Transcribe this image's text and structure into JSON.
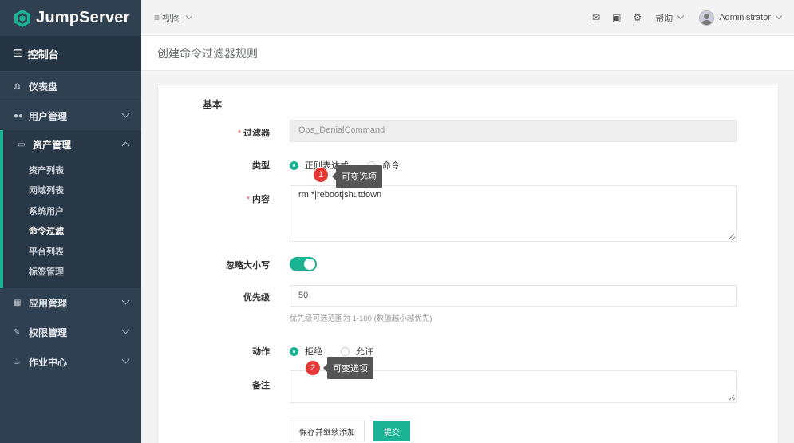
{
  "sidebar": {
    "brand": "JumpServer",
    "console": "控制台",
    "items": [
      {
        "label": "仪表盘"
      },
      {
        "label": "用户管理"
      },
      {
        "label": "资产管理"
      },
      {
        "label": "应用管理"
      },
      {
        "label": "权限管理"
      },
      {
        "label": "作业中心"
      }
    ],
    "subitems": [
      {
        "label": "资产列表"
      },
      {
        "label": "网域列表"
      },
      {
        "label": "系统用户"
      },
      {
        "label": "命令过滤"
      },
      {
        "label": "平台列表"
      },
      {
        "label": "标签管理"
      }
    ]
  },
  "topbar": {
    "view": "视图",
    "help": "帮助",
    "user": "Administrator"
  },
  "page": {
    "title": "创建命令过滤器规则"
  },
  "form": {
    "section": "基本",
    "filter_label": "过滤器",
    "filter_value": "Ops_DenialCommand",
    "type_label": "类型",
    "type_options": [
      "正则表达式",
      "命令"
    ],
    "content_label": "内容",
    "content_value": "rm.*|reboot|shutdown",
    "ignore_case_label": "忽略大小写",
    "priority_label": "优先级",
    "priority_value": "50",
    "priority_help": "优先级可选范围为 1-100 (数值越小越优先)",
    "action_label": "动作",
    "action_options": [
      "拒绝",
      "允许"
    ],
    "comment_label": "备注",
    "comment_value": "",
    "save_continue": "保存并继续添加",
    "submit": "提交"
  },
  "callouts": [
    {
      "number": "1",
      "text": "可变选项"
    },
    {
      "number": "2",
      "text": "可变选项"
    }
  ],
  "colors": {
    "sidebar_bg": "#2f4050",
    "accent": "#1ab394",
    "badge": "#e53935"
  }
}
